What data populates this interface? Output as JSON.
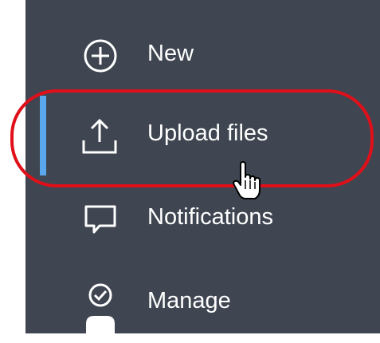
{
  "menu": {
    "items": [
      {
        "label": "New",
        "icon": "plus-circle-icon"
      },
      {
        "label": "Upload files",
        "icon": "upload-icon",
        "selected": true
      },
      {
        "label": "Notifications",
        "icon": "chat-bubble-icon"
      },
      {
        "label": "Manage",
        "icon": "user-check-icon"
      }
    ]
  },
  "colors": {
    "panel_bg": "#3f4651",
    "text": "#ffffff",
    "selected_bar": "#5aa7ee",
    "annotation_ring": "#e0101a"
  }
}
